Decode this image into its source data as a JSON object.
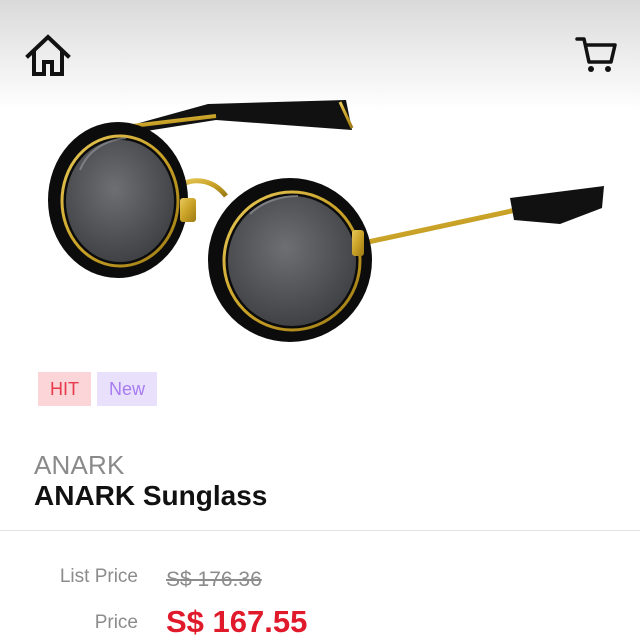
{
  "header": {
    "home_icon": "home-icon",
    "cart_icon": "cart-icon"
  },
  "product": {
    "image_subject": "round sunglasses",
    "badges": [
      "HIT",
      "New"
    ],
    "brand": "ANARK",
    "name": "ANARK Sunglass"
  },
  "pricing": {
    "list_price_label": "List Price",
    "list_price_value": "S$ 176.36",
    "price_label": "Price",
    "price_value": "S$ 167.55"
  },
  "colors": {
    "badge_hit_bg": "#fbd5d8",
    "badge_hit_text": "#e8394a",
    "badge_new_bg": "#e9e1fb",
    "badge_new_text": "#a77bf0",
    "price_red": "#e01a2b",
    "frame_gold": "#c9a227"
  }
}
